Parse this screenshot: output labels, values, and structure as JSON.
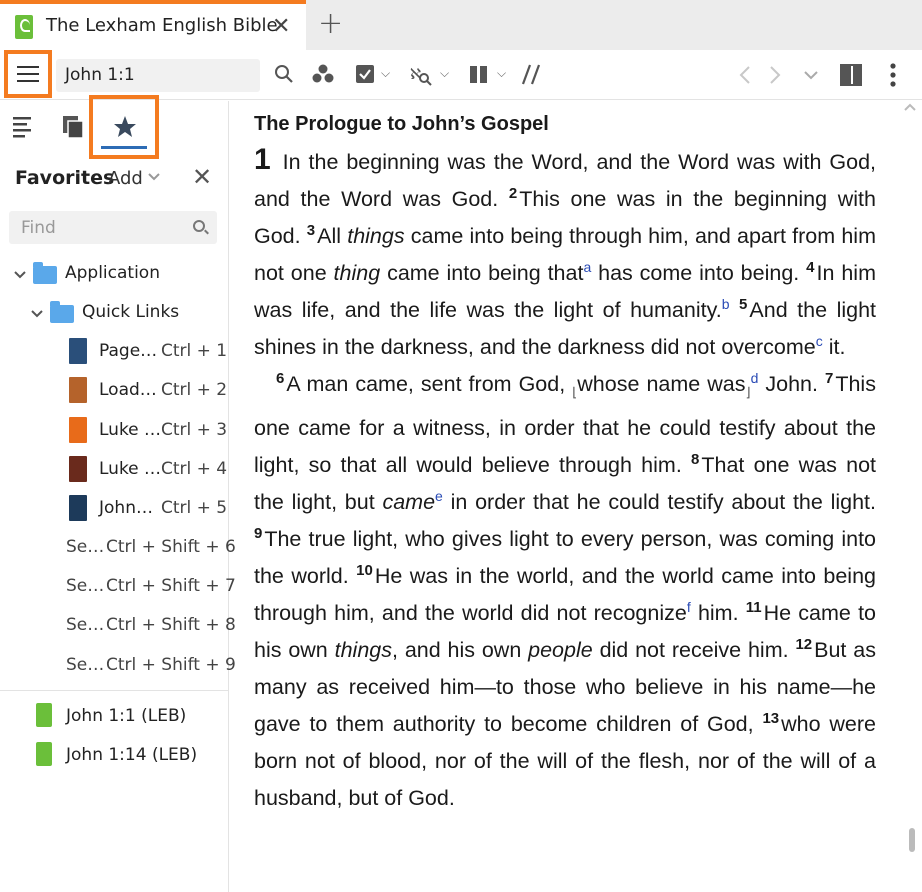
{
  "tab": {
    "title": "The Lexham English Bible",
    "close": "✕",
    "add": "+"
  },
  "toolbar": {
    "reference": "John 1:1"
  },
  "sidebar": {
    "favorites_title": "Favorites",
    "add_label": "Add",
    "close": "✕",
    "find_placeholder": "Find",
    "tree": {
      "application": "Application",
      "quick_links": "Quick Links",
      "items": [
        {
          "label": "Page…",
          "shortcut": "Ctrl + 1",
          "color": "#2a4f7a"
        },
        {
          "label": "Load…",
          "shortcut": "Ctrl + 2",
          "color": "#b5632b"
        },
        {
          "label": "Luke …",
          "shortcut": "Ctrl + 3",
          "color": "#e86b1a"
        },
        {
          "label": "Luke …",
          "shortcut": "Ctrl + 4",
          "color": "#6a2a1c"
        },
        {
          "label": "John…",
          "shortcut": "Ctrl + 5",
          "color": "#1d3a5a"
        }
      ],
      "shortcuts": [
        {
          "label": "Se…",
          "shortcut": "Ctrl + Shift + 6"
        },
        {
          "label": "Se…",
          "shortcut": "Ctrl + Shift + 7"
        },
        {
          "label": "Se…",
          "shortcut": "Ctrl + Shift + 8"
        },
        {
          "label": "Se…",
          "shortcut": "Ctrl + Shift + 9"
        }
      ]
    },
    "favorites": [
      "John 1:1 (LEB)",
      "John 1:14 (LEB)"
    ]
  },
  "reader": {
    "heading": "The Prologue to John’s Gospel",
    "v1": "1",
    "t1": "In the beginning was the Word, and the Word was with God, and the Word was God.",
    "v2": "2",
    "t2": "This one was in the beginning with God.",
    "v3": "3",
    "t3a": "All",
    "t3b": "things",
    "t3c": "came into being through him, and apart from him not one",
    "t3d": "thing",
    "t3e": "came into being that",
    "fa": "a",
    "t3f": "has come into being.",
    "v4": "4",
    "t4": "In him was life, and the life was the light of humanity.",
    "fb": "b",
    "v5": "5",
    "t5": "And the light shines in the darkness, and the darkness did not overcome",
    "fc": "c",
    "t5b": "it.",
    "v6": "6",
    "t6a": "A man came, sent from God,",
    "t6b": "whose name was",
    "fd": "d",
    "t6c": "John.",
    "v7": "7",
    "t7": "This one came for a witness, in order that he could testify about the light, so that all would believe through him.",
    "v8": "8",
    "t8a": "That one was not the light, but",
    "t8b": "came",
    "fe": "e",
    "t8c": "in order that he could tes­tify about the light.",
    "v9": "9",
    "t9": "The true light, who gives light to every person, was coming into the world.",
    "v10": "10",
    "t10": "He was in the world, and the world came into being through him, and the world did not recognize",
    "ff": "f",
    "t10b": "him.",
    "v11": "11",
    "t11a": "He came to his own",
    "t11b": "things",
    "t11c": ", and his own",
    "t11d": "people",
    "t11e": "did not receive him.",
    "v12": "12",
    "t12": "But as many as received him—to those who believe in his name—he gave to them authority to become children of God,",
    "v13": "13",
    "t13": "who were born not of blood, nor of the will of the flesh, nor of the will of a hus­band, but of God."
  }
}
